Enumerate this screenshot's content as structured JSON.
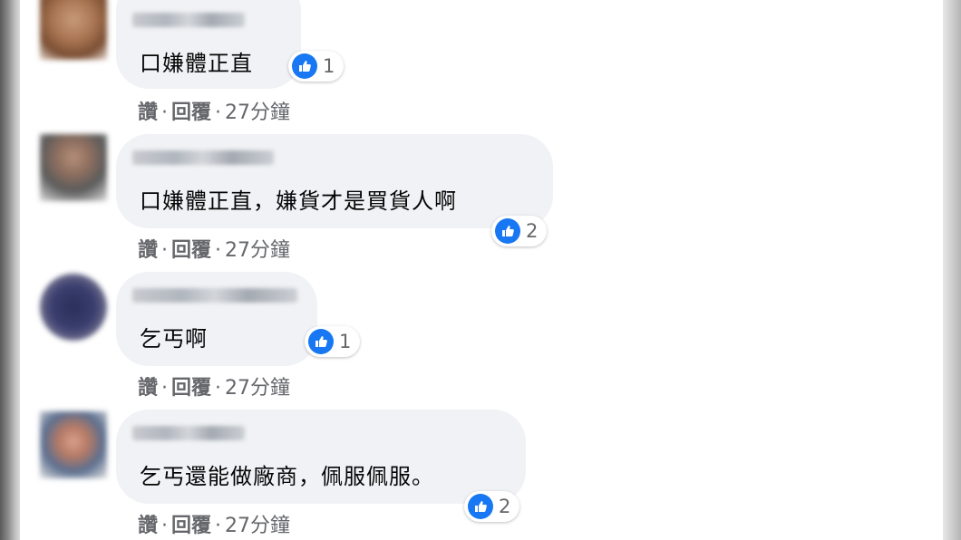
{
  "comments": [
    {
      "text": "口嫌體正直",
      "likes": "1",
      "actions": {
        "like": "讚",
        "separator": "·",
        "reply": "回覆",
        "time": "27分鐘"
      }
    },
    {
      "text": "口嫌體正直，嫌貨才是買貨人啊",
      "likes": "2",
      "actions": {
        "like": "讚",
        "separator": "·",
        "reply": "回覆",
        "time": "27分鐘"
      }
    },
    {
      "text": "乞丐啊",
      "likes": "1",
      "actions": {
        "like": "讚",
        "separator": "·",
        "reply": "回覆",
        "time": "27分鐘"
      }
    },
    {
      "text": "乞丐還能做廠商，佩服佩服。",
      "likes": "2",
      "actions": {
        "like": "讚",
        "separator": "·",
        "reply": "回覆",
        "time": "27分鐘"
      }
    }
  ],
  "colors": {
    "like_blue": "#1877f2",
    "bubble_bg": "#f0f2f5",
    "meta_text": "#65676b"
  }
}
